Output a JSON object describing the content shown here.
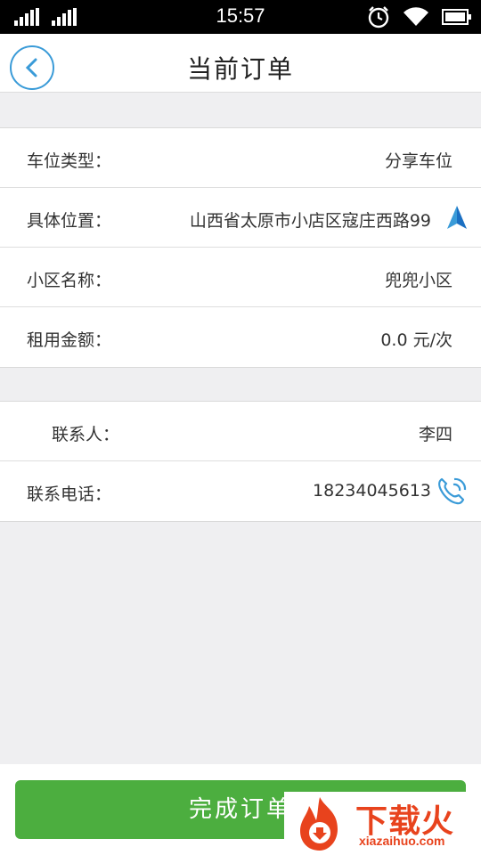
{
  "status_bar": {
    "time": "15:57",
    "icons": [
      "signal-icon",
      "signal-icon",
      "alarm-icon",
      "wifi-icon",
      "battery-icon"
    ]
  },
  "header": {
    "title": "当前订单",
    "back_icon": "chevron-left-icon"
  },
  "order_info": {
    "rows": [
      {
        "label": "车位类型：",
        "value": "分享车位"
      },
      {
        "label": "具体位置：",
        "value": "山西省太原市小店区寇庄西路99",
        "icon": "navigation-arrow-icon"
      },
      {
        "label": "小区名称：",
        "value": "兜兜小区"
      },
      {
        "label": "租用金额：",
        "value": "0.0 元/次"
      }
    ]
  },
  "contact_info": {
    "rows": [
      {
        "label": "联系人：",
        "value": "李四"
      },
      {
        "label": "联系电话：",
        "value": "18234045613",
        "icon": "phone-icon"
      }
    ]
  },
  "actions": {
    "complete_label": "完成订单"
  },
  "watermark": {
    "brand": "下载火",
    "url": "xiazaihuo.com"
  },
  "colors": {
    "accent_blue": "#3a9bd8",
    "button_green": "#4cae3f",
    "watermark_red": "#e8431d",
    "background": "#efeff1"
  }
}
